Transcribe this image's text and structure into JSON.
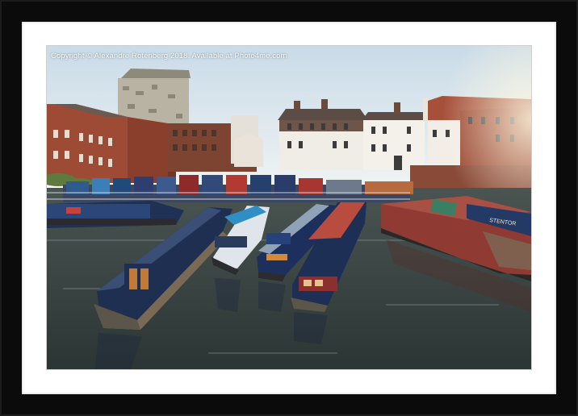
{
  "image": {
    "subject": "frame-print-canal-basin",
    "copyright_text": "Copyright © Alexandre Rotenberg 2018. Available at Photo4me.com"
  },
  "colors": {
    "frame": "#0b0b0b",
    "mount": "#ffffff",
    "sky": "#d9e6ef",
    "water": "#34403f",
    "brick": "#9a4a35",
    "boat_blue": "#243a66"
  },
  "boats": [
    {
      "name": "STENTOR"
    }
  ]
}
